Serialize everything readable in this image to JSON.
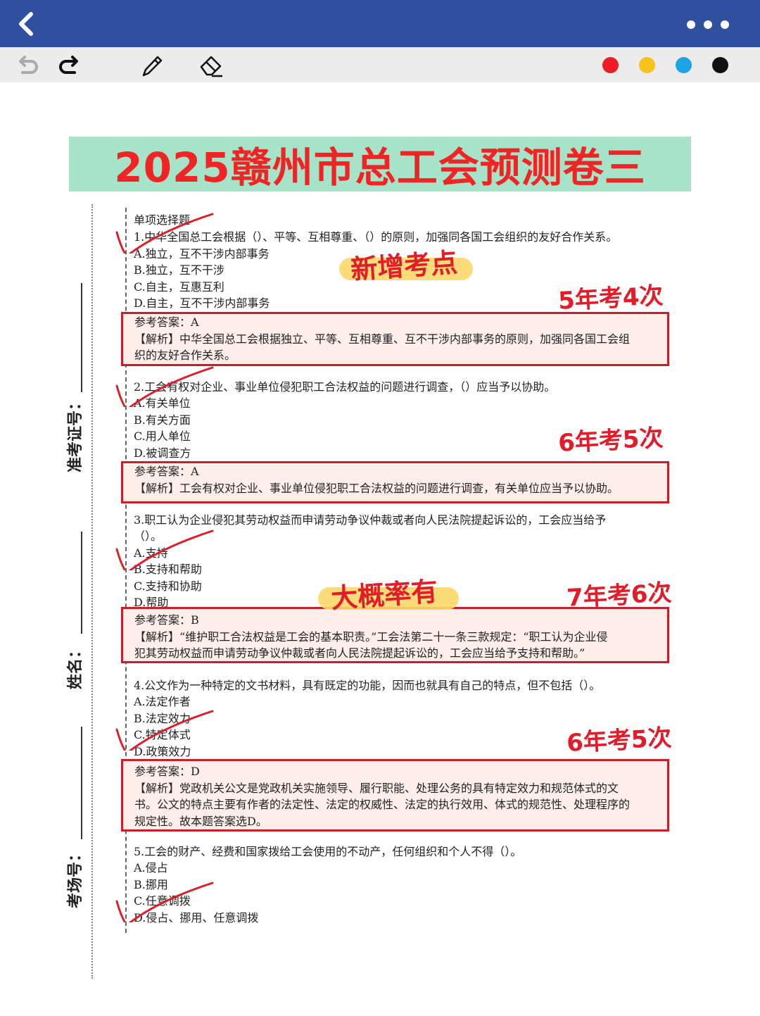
{
  "toolbar": {
    "colors": [
      "#ee1c25",
      "#f8c21c",
      "#1ea3e6",
      "#111111"
    ]
  },
  "banner": {
    "title": "2025赣州市总工会预测卷三"
  },
  "sidebar": {
    "exam_id_label": "准考证号：",
    "name_label": "姓名：",
    "room_label": "考场号："
  },
  "section_title": "单项选择题",
  "questions": [
    {
      "stem": "1.中华全国总工会根据（）、平等、互相尊重、（）的原则，加强同各国工会组织的友好合作关系。",
      "options": [
        "A.独立，互不干涉内部事务",
        "B.独立，互不干涉",
        "C.自主，互惠互利",
        "D.自主，互不干涉内部事务"
      ],
      "answer": "参考答案：A",
      "analysis": [
        "【解析】中华全国总工会根据独立、平等、互相尊重、互不干涉内部事务的原则，加强同各国工会组",
        "织的友好合作关系。"
      ],
      "tag": "新增考点",
      "freq": "5年考4次"
    },
    {
      "stem": "2.工会有权对企业、事业单位侵犯职工合法权益的问题进行调查，（）应当予以协助。",
      "options": [
        "A.有关单位",
        "B.有关方面",
        "C.用人单位",
        "D.被调查方"
      ],
      "answer": "参考答案：A",
      "analysis": [
        "【解析】工会有权对企业、事业单位侵犯职工合法权益的问题进行调查，有关单位应当予以协助。"
      ],
      "freq": "6年考5次"
    },
    {
      "stem": "3.职工认为企业侵犯其劳动权益而申请劳动争议仲裁或者向人民法院提起诉讼的，工会应当给予",
      "stem2": "（）。",
      "options": [
        "A.支持",
        "B.支持和帮助",
        "C.支持和协助",
        "D.帮助"
      ],
      "answer": "参考答案：B",
      "analysis": [
        "【解析】“维护职工合法权益是工会的基本职责。”工会法第二十一条三款规定：“职工认为企业侵",
        "犯其劳动权益而申请劳动争议仲裁或者向人民法院提起诉讼的，工会应当给予支持和帮助。”"
      ],
      "tag": "大概率有",
      "freq": "7年考6次"
    },
    {
      "stem": "4.公文作为一种特定的文书材料，具有既定的功能，因而也就具有自己的特点，但不包括（）。",
      "options": [
        "A.法定作者",
        "B.法定效力",
        "C.特定体式",
        "D.政策效力"
      ],
      "answer": "参考答案：D",
      "analysis": [
        "【解析】党政机关公文是党政机关实施领导、履行职能、处理公务的具有特定效力和规范体式的文",
        "书。公文的特点主要有作者的法定性、法定的权威性、法定的执行效用、体式的规范性、处理程序的",
        "规定性。故本题答案选D。"
      ],
      "freq": "6年考5次"
    },
    {
      "stem": "5.工会的财产、经费和国家拨给工会使用的不动产，任何组织和个人不得（）。",
      "options": [
        "A.侵占",
        "B.挪用",
        "C.任意调拨",
        "D.侵占、挪用、任意调拨"
      ]
    }
  ]
}
